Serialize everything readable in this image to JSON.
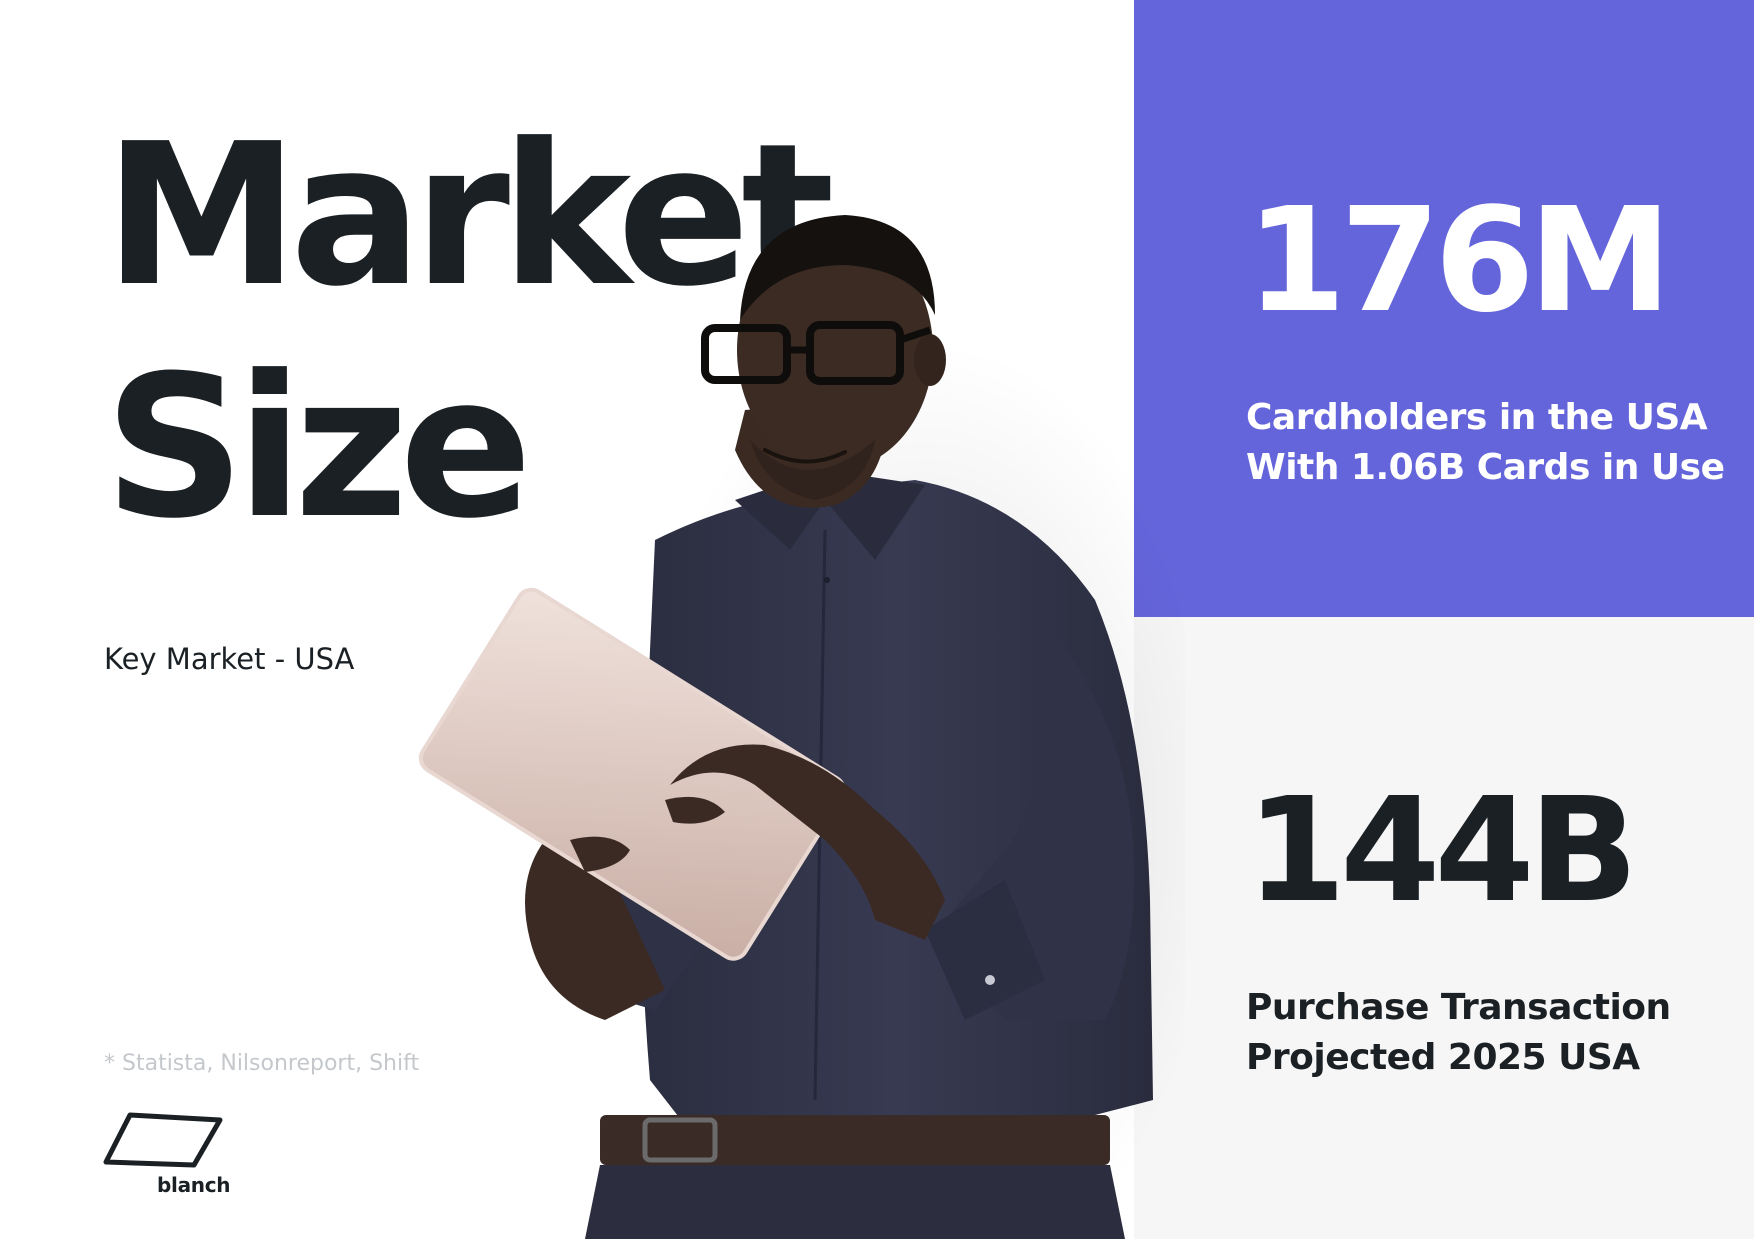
{
  "title": {
    "line1": "Market",
    "line2": "Size"
  },
  "subtitle": "Key Market - USA",
  "sources": "* Statista, Nilsonreport, Shift",
  "logo": {
    "text": "blanch",
    "icon": "parallelogram-logo-icon"
  },
  "stats": [
    {
      "value": "176M",
      "label_line1": "Cardholders in the USA",
      "label_line2": "With 1.06B Cards in Use"
    },
    {
      "value": "144B",
      "label_line1": "Purchase Transaction",
      "label_line2": "Projected 2025 USA"
    }
  ],
  "colors": {
    "accent_panel": "#6565db",
    "light_panel": "#f6f6f6",
    "text_dark": "#1a2024",
    "text_muted": "#c4c8cc"
  }
}
